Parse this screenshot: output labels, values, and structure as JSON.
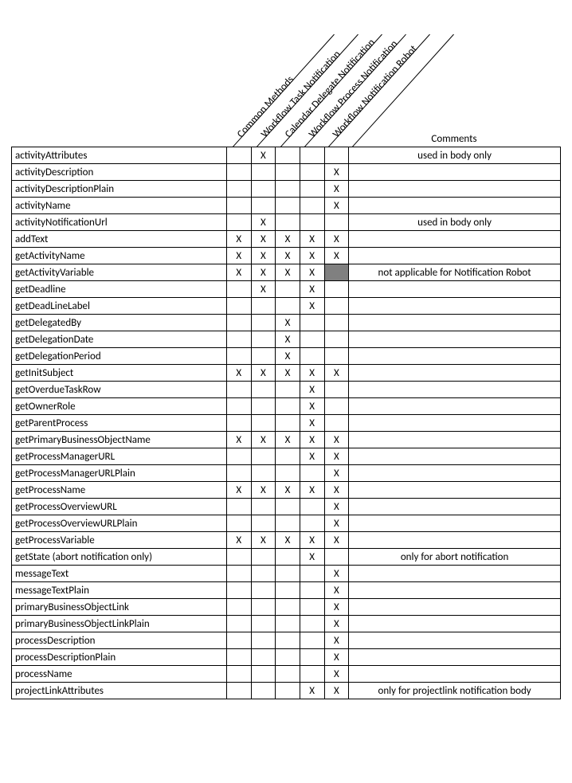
{
  "columns": [
    "Common Methods",
    "Workflow Task Notification",
    "Calendar Delegate Notification",
    "Workflow Process Notification",
    "Workflow Notification Robot"
  ],
  "commentsHeader": "Comments",
  "mark": "X",
  "rows": [
    {
      "method": "activityAttributes",
      "cells": [
        "",
        "X",
        "",
        "",
        ""
      ],
      "comment": "used in body only"
    },
    {
      "method": "activityDescription",
      "cells": [
        "",
        "",
        "",
        "",
        "X"
      ],
      "comment": ""
    },
    {
      "method": "activityDescriptionPlain",
      "cells": [
        "",
        "",
        "",
        "",
        "X"
      ],
      "comment": ""
    },
    {
      "method": "activityName",
      "cells": [
        "",
        "",
        "",
        "",
        "X"
      ],
      "comment": ""
    },
    {
      "method": "activityNotificationUrl",
      "cells": [
        "",
        "X",
        "",
        "",
        ""
      ],
      "comment": "used in body only"
    },
    {
      "method": "addText",
      "cells": [
        "X",
        "X",
        "X",
        "X",
        "X"
      ],
      "comment": ""
    },
    {
      "method": "getActivityName",
      "cells": [
        "X",
        "X",
        "X",
        "X",
        "X"
      ],
      "comment": ""
    },
    {
      "method": "getActivityVariable",
      "cells": [
        "X",
        "X",
        "X",
        "X",
        "SHADED"
      ],
      "comment": "not applicable for Notification Robot"
    },
    {
      "method": "getDeadline",
      "cells": [
        "",
        "X",
        "",
        "X",
        ""
      ],
      "comment": ""
    },
    {
      "method": "getDeadLineLabel",
      "cells": [
        "",
        "",
        "",
        "X",
        ""
      ],
      "comment": ""
    },
    {
      "method": "getDelegatedBy",
      "cells": [
        "",
        "",
        "X",
        "",
        ""
      ],
      "comment": ""
    },
    {
      "method": "getDelegationDate",
      "cells": [
        "",
        "",
        "X",
        "",
        ""
      ],
      "comment": ""
    },
    {
      "method": "getDelegationPeriod",
      "cells": [
        "",
        "",
        "X",
        "",
        ""
      ],
      "comment": ""
    },
    {
      "method": "getInitSubject",
      "cells": [
        "X",
        "X",
        "X",
        "X",
        "X"
      ],
      "comment": ""
    },
    {
      "method": "getOverdueTaskRow",
      "cells": [
        "",
        "",
        "",
        "X",
        ""
      ],
      "comment": ""
    },
    {
      "method": "getOwnerRole",
      "cells": [
        "",
        "",
        "",
        "X",
        ""
      ],
      "comment": ""
    },
    {
      "method": "getParentProcess",
      "cells": [
        "",
        "",
        "",
        "X",
        ""
      ],
      "comment": ""
    },
    {
      "method": "getPrimaryBusinessObjectName",
      "cells": [
        "X",
        "X",
        "X",
        "X",
        "X"
      ],
      "comment": ""
    },
    {
      "method": "getProcessManagerURL",
      "cells": [
        "",
        "",
        "",
        "X",
        "X"
      ],
      "comment": ""
    },
    {
      "method": "getProcessManagerURLPlain",
      "cells": [
        "",
        "",
        "",
        "",
        "X"
      ],
      "comment": ""
    },
    {
      "method": "getProcessName",
      "cells": [
        "X",
        "X",
        "X",
        "X",
        "X"
      ],
      "comment": ""
    },
    {
      "method": "getProcessOverviewURL",
      "cells": [
        "",
        "",
        "",
        "",
        "X"
      ],
      "comment": ""
    },
    {
      "method": "getProcessOverviewURLPlain",
      "cells": [
        "",
        "",
        "",
        "",
        "X"
      ],
      "comment": ""
    },
    {
      "method": "getProcessVariable",
      "cells": [
        "X",
        "X",
        "X",
        "X",
        "X"
      ],
      "comment": ""
    },
    {
      "method": "getState (abort notification only)",
      "cells": [
        "",
        "",
        "",
        "X",
        ""
      ],
      "comment": "only for abort notification"
    },
    {
      "method": "messageText",
      "cells": [
        "",
        "",
        "",
        "",
        "X"
      ],
      "comment": ""
    },
    {
      "method": "messageTextPlain",
      "cells": [
        "",
        "",
        "",
        "",
        "X"
      ],
      "comment": ""
    },
    {
      "method": "primaryBusinessObjectLink",
      "cells": [
        "",
        "",
        "",
        "",
        "X"
      ],
      "comment": ""
    },
    {
      "method": "primaryBusinessObjectLinkPlain",
      "cells": [
        "",
        "",
        "",
        "",
        "X"
      ],
      "comment": ""
    },
    {
      "method": "processDescription",
      "cells": [
        "",
        "",
        "",
        "",
        "X"
      ],
      "comment": ""
    },
    {
      "method": "processDescriptionPlain",
      "cells": [
        "",
        "",
        "",
        "",
        "X"
      ],
      "comment": ""
    },
    {
      "method": "processName",
      "cells": [
        "",
        "",
        "",
        "",
        "X"
      ],
      "comment": ""
    },
    {
      "method": "projectLinkAttributes",
      "cells": [
        "",
        "",
        "",
        "X",
        "X"
      ],
      "comment": "only for projectlink notification body"
    }
  ]
}
